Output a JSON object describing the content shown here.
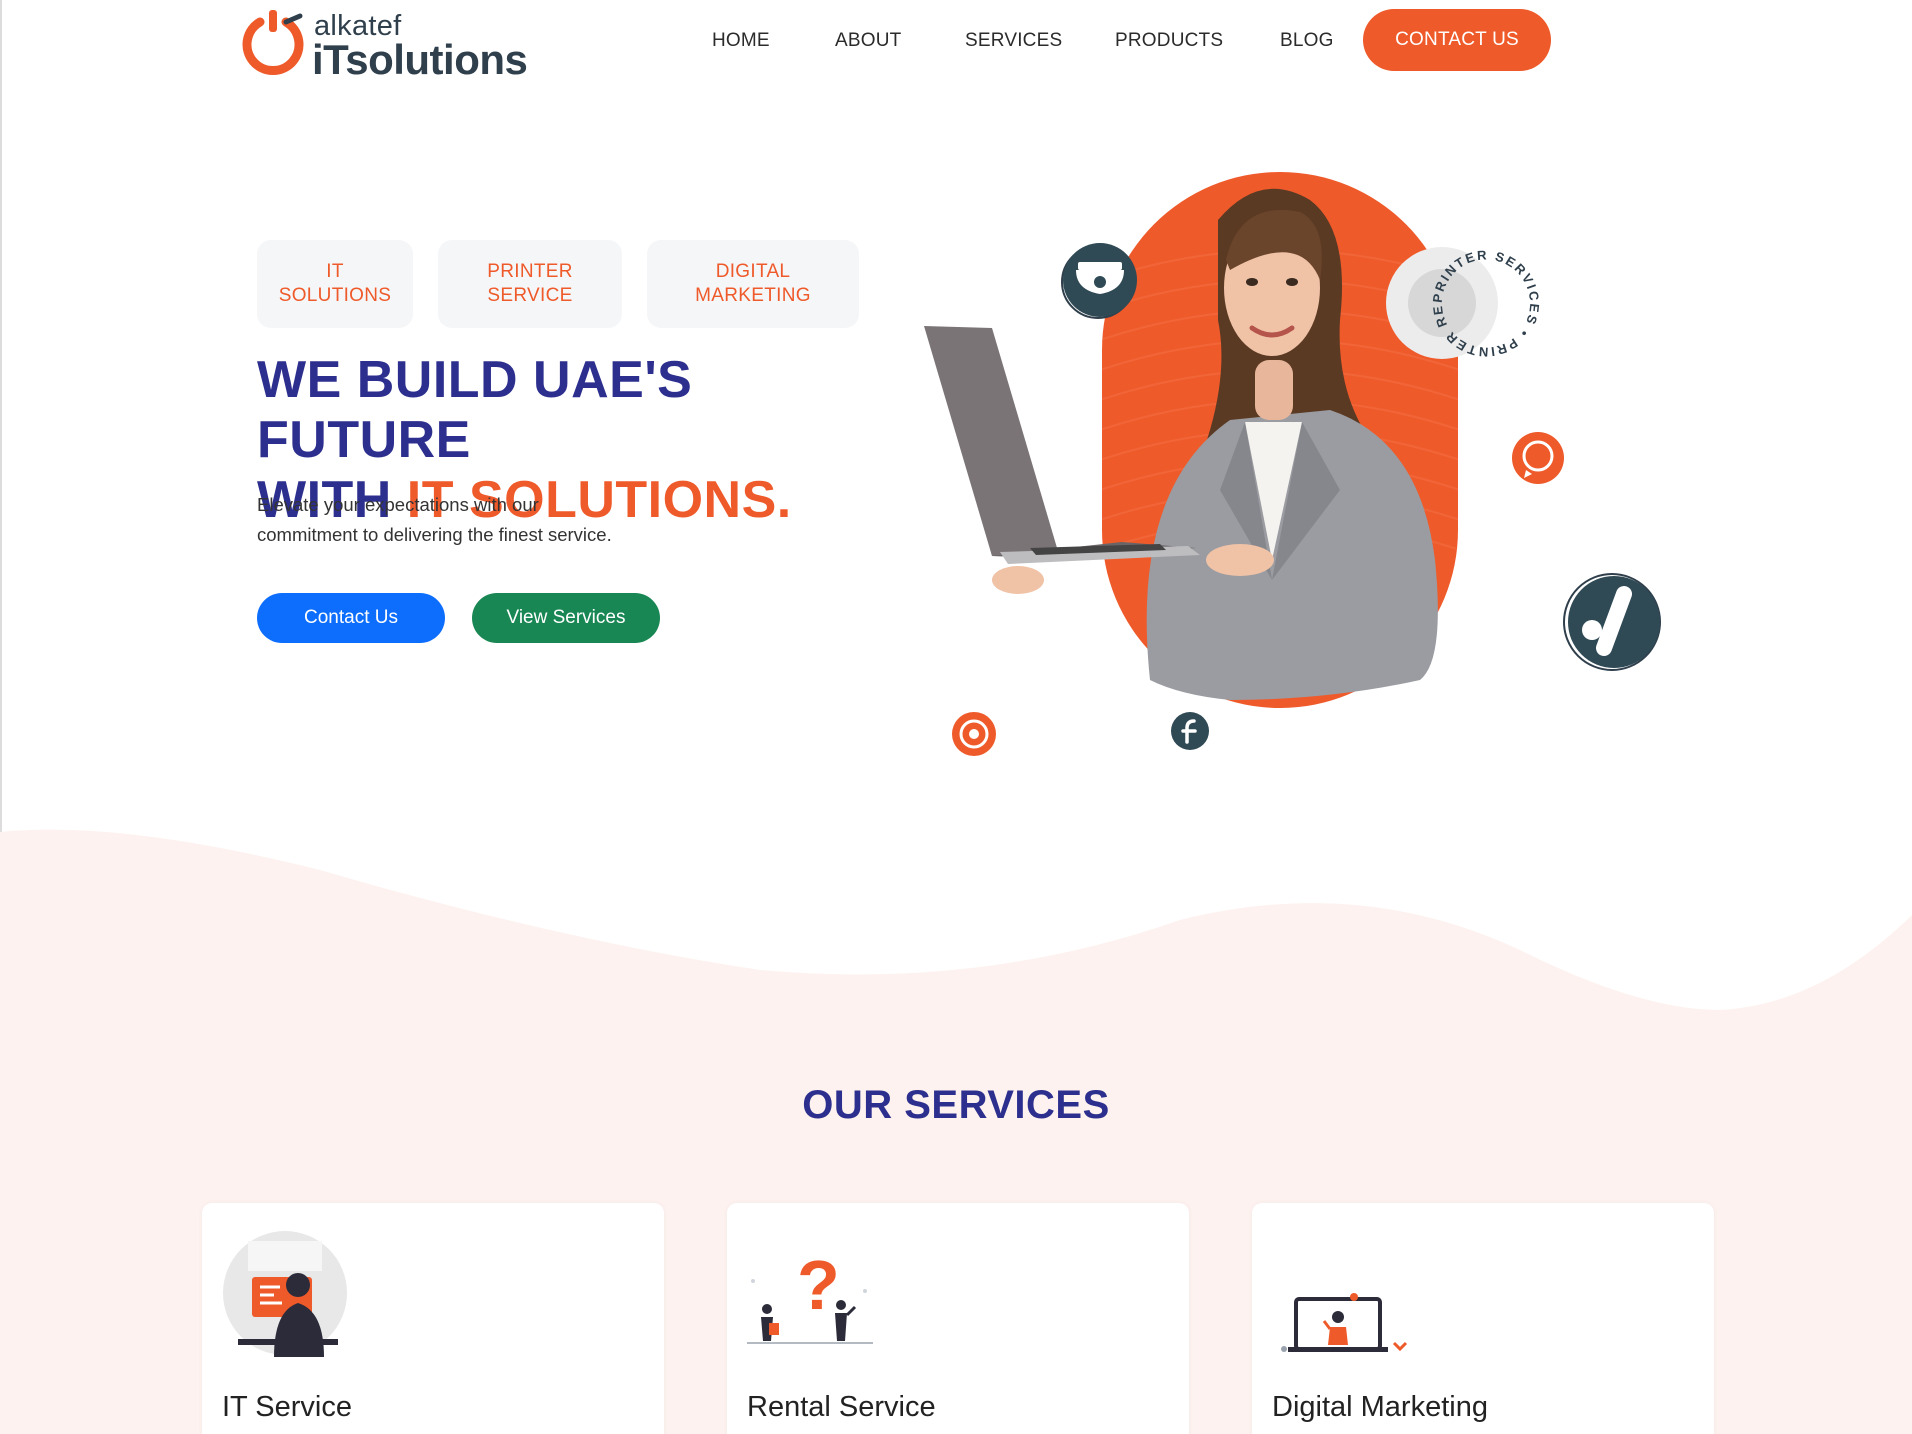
{
  "header": {
    "logo": {
      "small": "alkatef",
      "big": "iTsolutions"
    },
    "nav": [
      "HOME",
      "ABOUT",
      "SERVICES",
      "PRODUCTS",
      "BLOG"
    ],
    "contact_label": "CONTACT US"
  },
  "hero": {
    "tags": [
      {
        "line1": "IT",
        "line2": "SOLUTIONS"
      },
      {
        "line1": "PRINTER",
        "line2": "SERVICE"
      },
      {
        "line1": "DIGITAL",
        "line2": "MARKETING"
      }
    ],
    "title_line1": "WE BUILD UAE'S FUTURE",
    "title_line2_prefix": "WITH ",
    "title_line2_accent": "IT SOLUTIONS.",
    "subtitle_line1": "Elevate your expectations with our",
    "subtitle_line2": "commitment to delivering the finest service.",
    "primary_button": "Contact Us",
    "secondary_button": "View Services",
    "badge_text": "PRINTER SERVICES • PRINTER RENTAL •"
  },
  "services": {
    "title": "OUR SERVICES",
    "cards": [
      {
        "title": "IT Service"
      },
      {
        "title": "Rental Service"
      },
      {
        "title": "Digital Marketing"
      }
    ]
  },
  "colors": {
    "accent": "#ef5a2a",
    "navy": "#2d2f8e",
    "dark_icon": "#2f3f4c",
    "primary_blue": "#0d6efd",
    "success_green": "#198754",
    "section_bg": "#fdf2ef"
  },
  "icons": [
    "power-logo-icon",
    "cctv-camera-icon",
    "whatsapp-icon",
    "google-ads-icon",
    "target-icon",
    "facebook-icon"
  ]
}
